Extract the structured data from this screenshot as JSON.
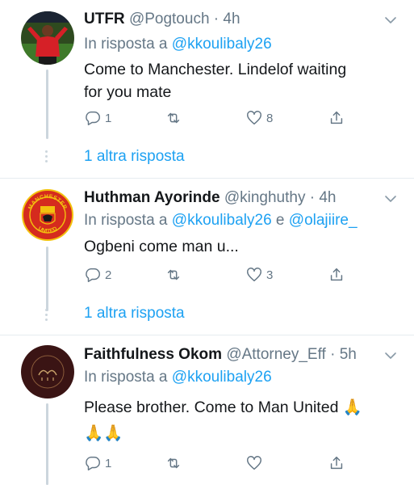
{
  "tweets": [
    {
      "name": "UTFR",
      "handle": "@Pogtouch",
      "time": "· 4h",
      "reply_prefix": "In risposta a",
      "reply_to": "@kkoulibaly26",
      "reply_joiner": "",
      "reply_to_2": "",
      "text_lines": [
        "Come to Manchester. Lindelof waiting",
        "for you mate"
      ],
      "reply_count": "1",
      "retweet_count": "",
      "like_count": "8",
      "more_replies": "1 altra risposta",
      "avatar_icon": "player-celebration-avatar"
    },
    {
      "name": "Huthman Ayorinde",
      "handle": "@kinghuthy",
      "time": "· 4h",
      "reply_prefix": "In risposta a",
      "reply_to": "@kkoulibaly26",
      "reply_joiner": "e",
      "reply_to_2": "@olajiire_",
      "text_lines": [
        "Ogbeni come man u..."
      ],
      "reply_count": "2",
      "retweet_count": "",
      "like_count": "3",
      "more_replies": "1 altra risposta",
      "avatar_icon": "manchester-united-crest-avatar",
      "crest_top": "MANCHESTER",
      "crest_bottom": "UNITED"
    },
    {
      "name": "Faithfulness Okom",
      "handle": "@Attorney_Eff",
      "time": "· 5h",
      "reply_prefix": "In risposta a",
      "reply_to": "@kkoulibaly26",
      "reply_joiner": "",
      "reply_to_2": "",
      "text_lines": [
        "Please brother. Come to Man United 🙏",
        "🙏🙏"
      ],
      "reply_count": "1",
      "retweet_count": "",
      "like_count": "",
      "avatar_icon": "dark-emblem-avatar"
    }
  ],
  "colors": {
    "accent": "#1da1f2",
    "muted": "#657786",
    "text": "#14171a",
    "thread_line": "#ccd6dd"
  }
}
